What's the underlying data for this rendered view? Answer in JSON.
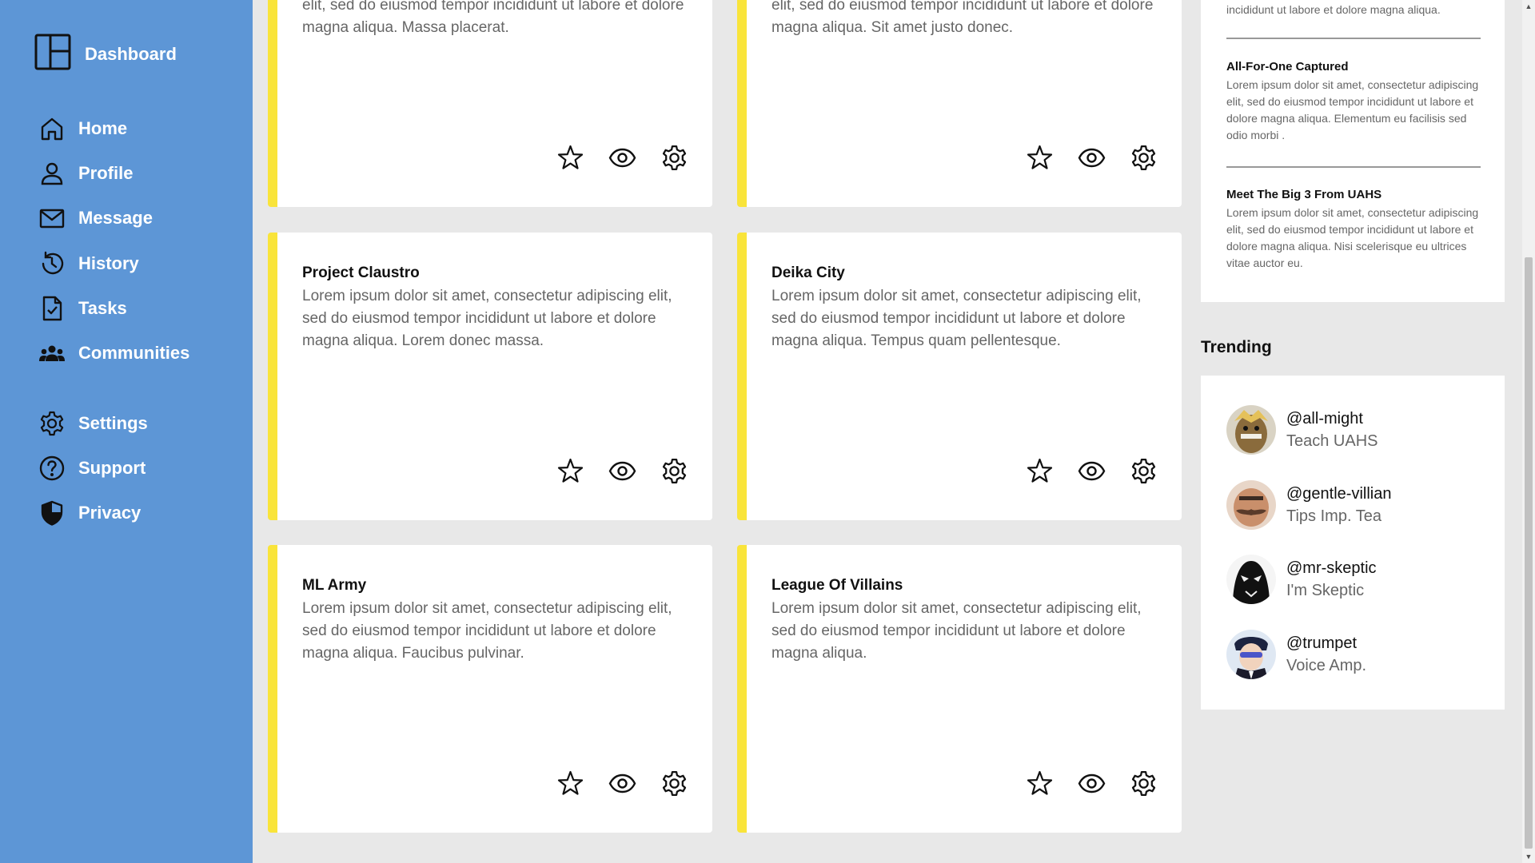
{
  "sidebar": {
    "brand": "Dashboard",
    "items": [
      {
        "label": "Home",
        "icon": "home-icon"
      },
      {
        "label": "Profile",
        "icon": "profile-icon"
      },
      {
        "label": "Message",
        "icon": "mail-icon"
      },
      {
        "label": "History",
        "icon": "history-icon"
      },
      {
        "label": "Tasks",
        "icon": "tasks-icon"
      },
      {
        "label": "Communities",
        "icon": "communities-icon"
      },
      {
        "label": "Settings",
        "icon": "gear-icon"
      },
      {
        "label": "Support",
        "icon": "help-icon"
      },
      {
        "label": "Privacy",
        "icon": "shield-icon"
      }
    ]
  },
  "cards": [
    {
      "title": "",
      "body": "elit, sed do eiusmod tempor incididunt ut labore et dolore magna aliqua. Massa placerat."
    },
    {
      "title": "",
      "body": "elit, sed do eiusmod tempor incididunt ut labore et dolore magna aliqua. Sit amet justo donec."
    },
    {
      "title": "Project Claustro",
      "body": "Lorem ipsum dolor sit amet, consectetur adipiscing elit, sed do eiusmod tempor incididunt ut labore et dolore magna aliqua. Lorem donec massa."
    },
    {
      "title": "Deika City",
      "body": "Lorem ipsum dolor sit amet, consectetur adipiscing elit, sed do eiusmod tempor incididunt ut labore et dolore magna aliqua. Tempus quam pellentesque."
    },
    {
      "title": "ML Army",
      "body": "Lorem ipsum dolor sit amet, consectetur adipiscing elit, sed do eiusmod tempor incididunt ut labore et dolore magna aliqua. Faucibus pulvinar."
    },
    {
      "title": "League Of Villains",
      "body": "Lorem ipsum dolor sit amet, consectetur adipiscing elit, sed do eiusmod tempor incididunt ut labore et dolore magna aliqua."
    }
  ],
  "news": [
    {
      "title": "",
      "text": "incididunt ut labore et dolore magna aliqua."
    },
    {
      "title": "All-For-One Captured",
      "text": "Lorem ipsum dolor sit amet, consectetur adipiscing elit, sed do eiusmod tempor incididunt ut labore et dolore magna aliqua. Elementum eu facilisis sed odio morbi ."
    },
    {
      "title": "Meet The Big 3 From UAHS",
      "text": "Lorem ipsum dolor sit amet, consectetur adipiscing elit, sed do eiusmod tempor incididunt ut labore et dolore magna aliqua. Nisi scelerisque eu ultrices vitae auctor eu."
    }
  ],
  "trending": {
    "heading": "Trending",
    "users": [
      {
        "handle": "@all-might",
        "subtitle": "Teach UAHS"
      },
      {
        "handle": "@gentle-villian",
        "subtitle": "Tips Imp. Tea"
      },
      {
        "handle": "@mr-skeptic",
        "subtitle": "I'm Skeptic"
      },
      {
        "handle": "@trumpet",
        "subtitle": "Voice Amp."
      }
    ]
  },
  "colors": {
    "sidebar": "#5d96d6",
    "card_accent": "#f9e43a",
    "background": "#e8e8e8"
  }
}
